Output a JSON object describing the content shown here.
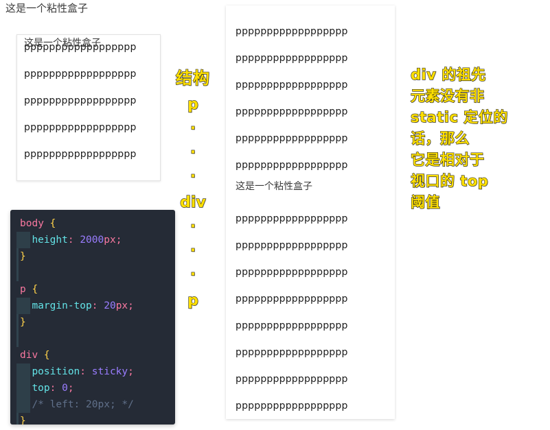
{
  "page": {
    "title": "这是一个粘性盒子"
  },
  "demo_box": {
    "sticky_label": "这是一个粘性盒子",
    "paragraphs": [
      "pppppppppppppppppp",
      "pppppppppppppppppp",
      "pppppppppppppppppp",
      "pppppppppppppppppp",
      "pppppppppppppppppp"
    ]
  },
  "code_block": {
    "language": "css",
    "background": "#252b36",
    "lines": [
      {
        "indent": 0,
        "guide": false,
        "tokens": [
          {
            "t": "body ",
            "c": "sel"
          },
          {
            "t": "{",
            "c": "brace"
          }
        ]
      },
      {
        "indent": 1,
        "guide": false,
        "tokens": [
          {
            "t": "height",
            "c": "prop"
          },
          {
            "t": ": ",
            "c": "punct"
          },
          {
            "t": "2000",
            "c": "num"
          },
          {
            "t": "px",
            "c": "unit"
          },
          {
            "t": ";",
            "c": "punct"
          }
        ]
      },
      {
        "indent": 0,
        "guide": true,
        "tokens": [
          {
            "t": "}",
            "c": "brace"
          }
        ]
      },
      {
        "indent": 0,
        "guide": true,
        "tokens": [
          {
            "t": "",
            "c": "punct"
          }
        ]
      },
      {
        "indent": 0,
        "guide": false,
        "tokens": [
          {
            "t": "p ",
            "c": "sel"
          },
          {
            "t": "{",
            "c": "brace"
          }
        ]
      },
      {
        "indent": 1,
        "guide": false,
        "tokens": [
          {
            "t": "margin-top",
            "c": "prop"
          },
          {
            "t": ": ",
            "c": "punct"
          },
          {
            "t": "20",
            "c": "num"
          },
          {
            "t": "px",
            "c": "unit"
          },
          {
            "t": ";",
            "c": "punct"
          }
        ]
      },
      {
        "indent": 0,
        "guide": true,
        "tokens": [
          {
            "t": "}",
            "c": "brace"
          }
        ]
      },
      {
        "indent": 0,
        "guide": true,
        "tokens": [
          {
            "t": "",
            "c": "punct"
          }
        ]
      },
      {
        "indent": 0,
        "guide": false,
        "tokens": [
          {
            "t": "div ",
            "c": "sel"
          },
          {
            "t": "{",
            "c": "brace"
          }
        ]
      },
      {
        "indent": 1,
        "guide": false,
        "tokens": [
          {
            "t": "position",
            "c": "prop"
          },
          {
            "t": ": ",
            "c": "punct"
          },
          {
            "t": "sticky",
            "c": "val"
          },
          {
            "t": ";",
            "c": "punct"
          }
        ]
      },
      {
        "indent": 1,
        "guide": false,
        "tokens": [
          {
            "t": "top",
            "c": "prop"
          },
          {
            "t": ": ",
            "c": "punct"
          },
          {
            "t": "0",
            "c": "num"
          },
          {
            "t": ";",
            "c": "punct"
          }
        ]
      },
      {
        "indent": 1,
        "guide": false,
        "tokens": [
          {
            "t": "/* left: 20px; */",
            "c": "cmt"
          }
        ]
      },
      {
        "indent": 0,
        "guide": true,
        "tokens": [
          {
            "t": "}",
            "c": "brace"
          }
        ]
      }
    ]
  },
  "structure_note": {
    "color": "#ffe000",
    "title": "结构",
    "items": [
      "p",
      "·",
      "·",
      "·",
      "div",
      "·",
      "·",
      "·",
      "p"
    ]
  },
  "content_column": {
    "paragraphs_before": [
      "pppppppppppppppppp",
      "pppppppppppppppppp",
      "pppppppppppppppppp",
      "pppppppppppppppppp",
      "pppppppppppppppppp",
      "pppppppppppppppppp"
    ],
    "sticky_label": "这是一个粘性盒子",
    "paragraphs_after": [
      "pppppppppppppppppp",
      "pppppppppppppppppp",
      "pppppppppppppppppp",
      "pppppppppppppppppp",
      "pppppppppppppppppp",
      "pppppppppppppppppp",
      "pppppppppppppppppp",
      "pppppppppppppppppp"
    ]
  },
  "right_note": {
    "color": "#ffe000",
    "lines": [
      "div 的祖先",
      "元素没有非",
      "static 定位的",
      "话，那么",
      "它是相对于",
      "视口的 top",
      "阈值"
    ]
  }
}
